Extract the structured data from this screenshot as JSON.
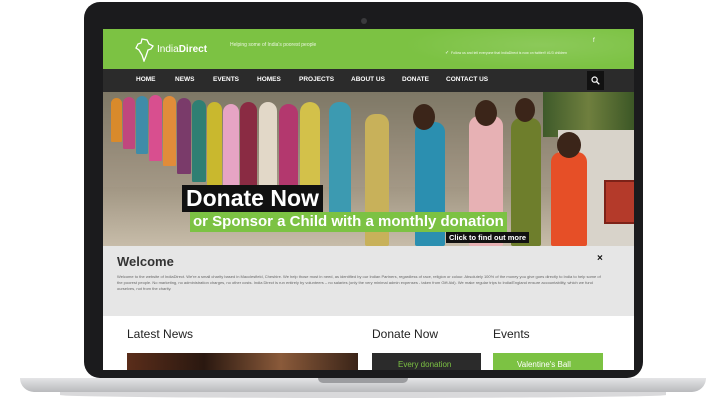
{
  "site": {
    "logo_prefix": "India",
    "logo_suffix": "Direct",
    "tagline": "Helping some of India's poorest people",
    "tweet": "Follow us and tell everyone that IndiaDirect is now on twitter!! #1/3 children"
  },
  "nav": {
    "items": [
      "HOME",
      "NEWS",
      "EVENTS",
      "HOMES",
      "PROJECTS",
      "ABOUT US",
      "DONATE",
      "CONTACT US"
    ]
  },
  "hero": {
    "headline": "Donate Now",
    "subline": "or Sponsor a Child with a monthly donation",
    "link": "Click to find out more"
  },
  "welcome": {
    "title": "Welcome",
    "body": "Welcome to the website of IndiaDirect. We're a small charity based in Macclesfield, Cheshire. We help those most in need, as identified by our Indian Partners, regardless of race, religion or colour. Absolutely 100% of the money you give goes directly to India to help some of the poorest people. No marketing, no administration charges, no other costs. India Direct is run entirely by volunteers – no salaries (only the very minimal admin expenses - taken from Gift Aid). We make regular trips to India/England ensure accountability, which we fund ourselves, not from the charity.",
    "close": "×"
  },
  "sections": {
    "news_title": "Latest News",
    "donate_title": "Donate Now",
    "donate_button": "Every donation",
    "events_title": "Events",
    "events_button": "Valentine's Ball"
  },
  "colors": {
    "brand_green": "#7cc243",
    "nav_dark": "#2b2b2b"
  },
  "icons": [
    "india-map-logo-icon",
    "facebook-icon",
    "twitter-icon",
    "search-icon",
    "close-icon"
  ]
}
